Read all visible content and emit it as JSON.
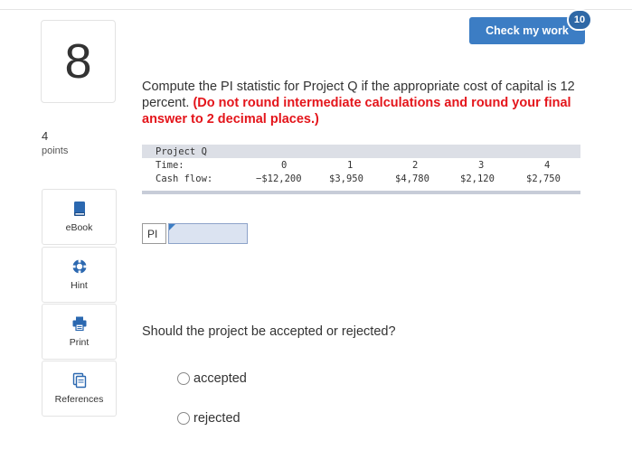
{
  "question": {
    "number": "8",
    "points_value": "4",
    "points_label": "points"
  },
  "check_my_work": {
    "label": "Check my work",
    "badge": "10",
    "color": "#3c7dc4"
  },
  "sidebar": {
    "tools": [
      {
        "label": "eBook",
        "icon": "book-icon"
      },
      {
        "label": "Hint",
        "icon": "lifebuoy-icon"
      },
      {
        "label": "Print",
        "icon": "printer-icon"
      },
      {
        "label": "References",
        "icon": "documents-icon"
      }
    ]
  },
  "prompt": {
    "text": "Compute the PI statistic for Project Q if the appropriate cost of capital is 12 percent.",
    "instruction": "(Do not round intermediate calculations and round your final answer to 2 decimal places.)",
    "instruction_color": "#e4151b"
  },
  "cash_flow_table": {
    "title": "Project Q",
    "time_label": "Time:",
    "cash_label": "Cash flow:",
    "times": [
      "0",
      "1",
      "2",
      "3",
      "4"
    ],
    "cash_flows": [
      "−$12,200",
      "$3,950",
      "$4,780",
      "$2,120",
      "$2,750"
    ]
  },
  "pi_field": {
    "label": "PI",
    "value": ""
  },
  "decision": {
    "question": "Should the project be accepted or rejected?",
    "options": [
      "accepted",
      "rejected"
    ]
  }
}
